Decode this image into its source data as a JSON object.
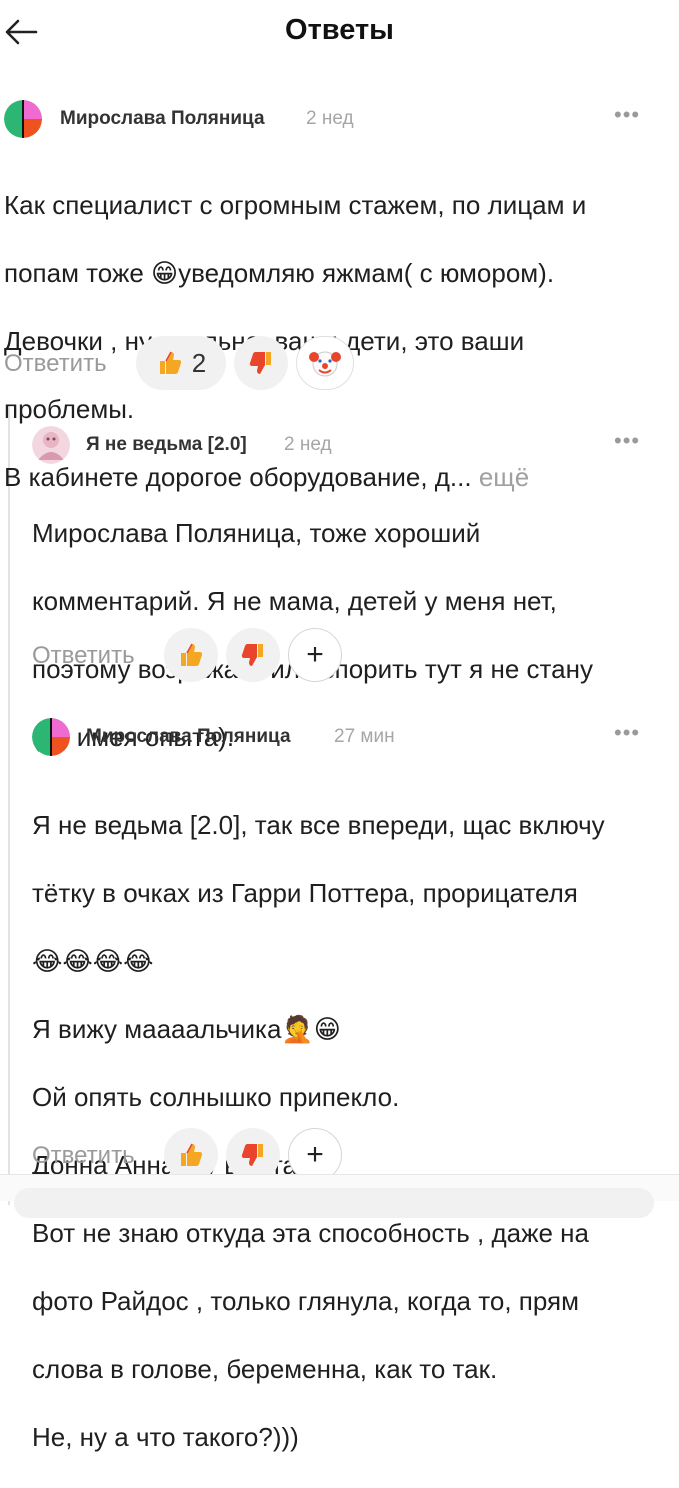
{
  "header": {
    "title": "Ответы",
    "back_icon": "arrow-left-icon"
  },
  "comments": [
    {
      "author": "Мирослава Поляница",
      "time": "2 нед",
      "text_lines": [
        "Как специалист с огромным стажем, по лицам и",
        "попам тоже 😁уведомляю яжмам( с юмором).",
        "Девочки , ну реально, ваши дети, это ваши",
        "проблемы.",
        "В кабинете дорогое оборудование, д..."
      ],
      "more_label": "ещё",
      "reply_label": "Ответить",
      "like_count": "2",
      "extra_reaction": "clown-face"
    },
    {
      "author": "Я не ведьма [2.0]",
      "time": "2 нед",
      "text_lines": [
        "Мирослава Поляница, тоже хороший",
        "комментарий. Я не мама, детей у меня нет,",
        "поэтому возражать или спорить тут я не стану",
        "(не имея опыта)."
      ],
      "reply_label": "Ответить",
      "plus_label": "+"
    },
    {
      "author": "Мирослава Поляница",
      "time": "27 мин",
      "text_lines": [
        "Я не ведьма [2.0], так все впереди, щас включу",
        "тётку в очках из Гарри Поттера, прорицателя",
        "😂😂😂😂",
        "Я вижу маааальчика🤦😁",
        "Ой опять солнышко припекло.",
        "Донна Анна, ну вот так.",
        "Вот не знаю откуда эта способность , даже на",
        "фото Райдос , только глянула, когда то, прям",
        "слова в голове, беременна, как то так.",
        "Не, ну а что такого?)))"
      ],
      "reply_label": "Ответить",
      "plus_label": "+"
    }
  ],
  "colors": {
    "like": "#f5a623",
    "dislike": "#e8452c",
    "text": "#1f1f1f",
    "muted": "#a0a0a0"
  }
}
